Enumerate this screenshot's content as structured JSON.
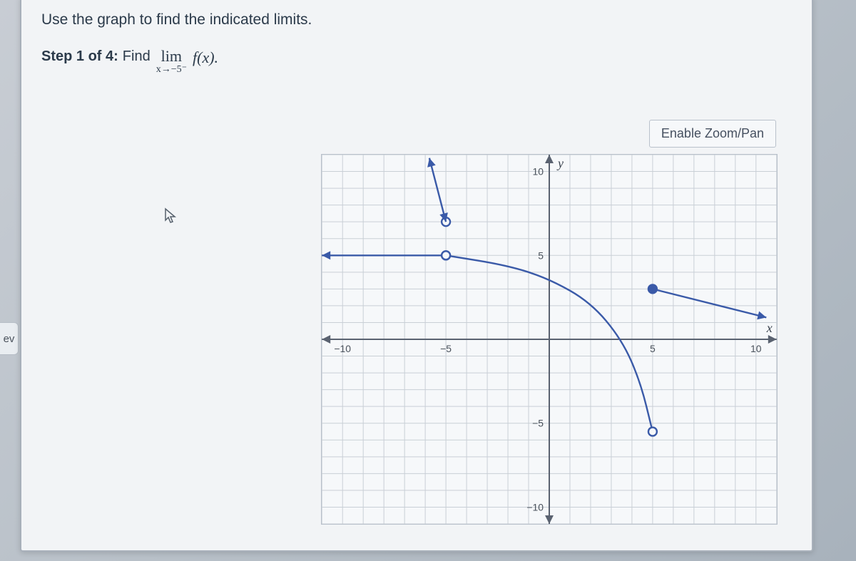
{
  "prompt": "Use the graph to find the indicated limits.",
  "step": {
    "label": "Step 1 of 4:",
    "find": "Find",
    "lim": "lim",
    "approach": "x→−5⁻",
    "fx": "f(x)."
  },
  "nav": {
    "prev": "ev"
  },
  "controls": {
    "zoom_pan": "Enable Zoom/Pan"
  },
  "chart_data": {
    "type": "line",
    "title": "",
    "xlabel": "x",
    "ylabel": "y",
    "xlim": [
      -11,
      11
    ],
    "ylim": [
      -11,
      11
    ],
    "xticks": [
      -10,
      -5,
      5,
      10
    ],
    "yticks": [
      -10,
      -5,
      5,
      10
    ],
    "grid": true,
    "series": [
      {
        "name": "segment-left",
        "type": "line-arrow-start",
        "points": [
          [
            -11,
            5
          ],
          [
            -5,
            5
          ]
        ],
        "end_style": "open",
        "end_point": [
          -5,
          5
        ]
      },
      {
        "name": "open-point-upper",
        "type": "point-open",
        "points": [
          [
            -5,
            7
          ]
        ]
      },
      {
        "name": "segment-up-arrow",
        "type": "line-arrow-end",
        "points": [
          [
            -5.8,
            10.8
          ],
          [
            -5,
            7
          ]
        ],
        "start_arrow": true
      },
      {
        "name": "curve-middle",
        "type": "curve",
        "points": [
          [
            -5,
            5
          ],
          [
            -2,
            4.4
          ],
          [
            0,
            3.6
          ],
          [
            2,
            2.2
          ],
          [
            3.5,
            0
          ],
          [
            4.4,
            -2.5
          ],
          [
            5,
            -5.5
          ]
        ],
        "start_style": "open",
        "end_style": "open"
      },
      {
        "name": "closed-point",
        "type": "point-closed",
        "points": [
          [
            5,
            3
          ]
        ]
      },
      {
        "name": "segment-right",
        "type": "line-arrow-end",
        "points": [
          [
            5,
            3
          ],
          [
            10.5,
            1.3
          ]
        ]
      }
    ]
  }
}
